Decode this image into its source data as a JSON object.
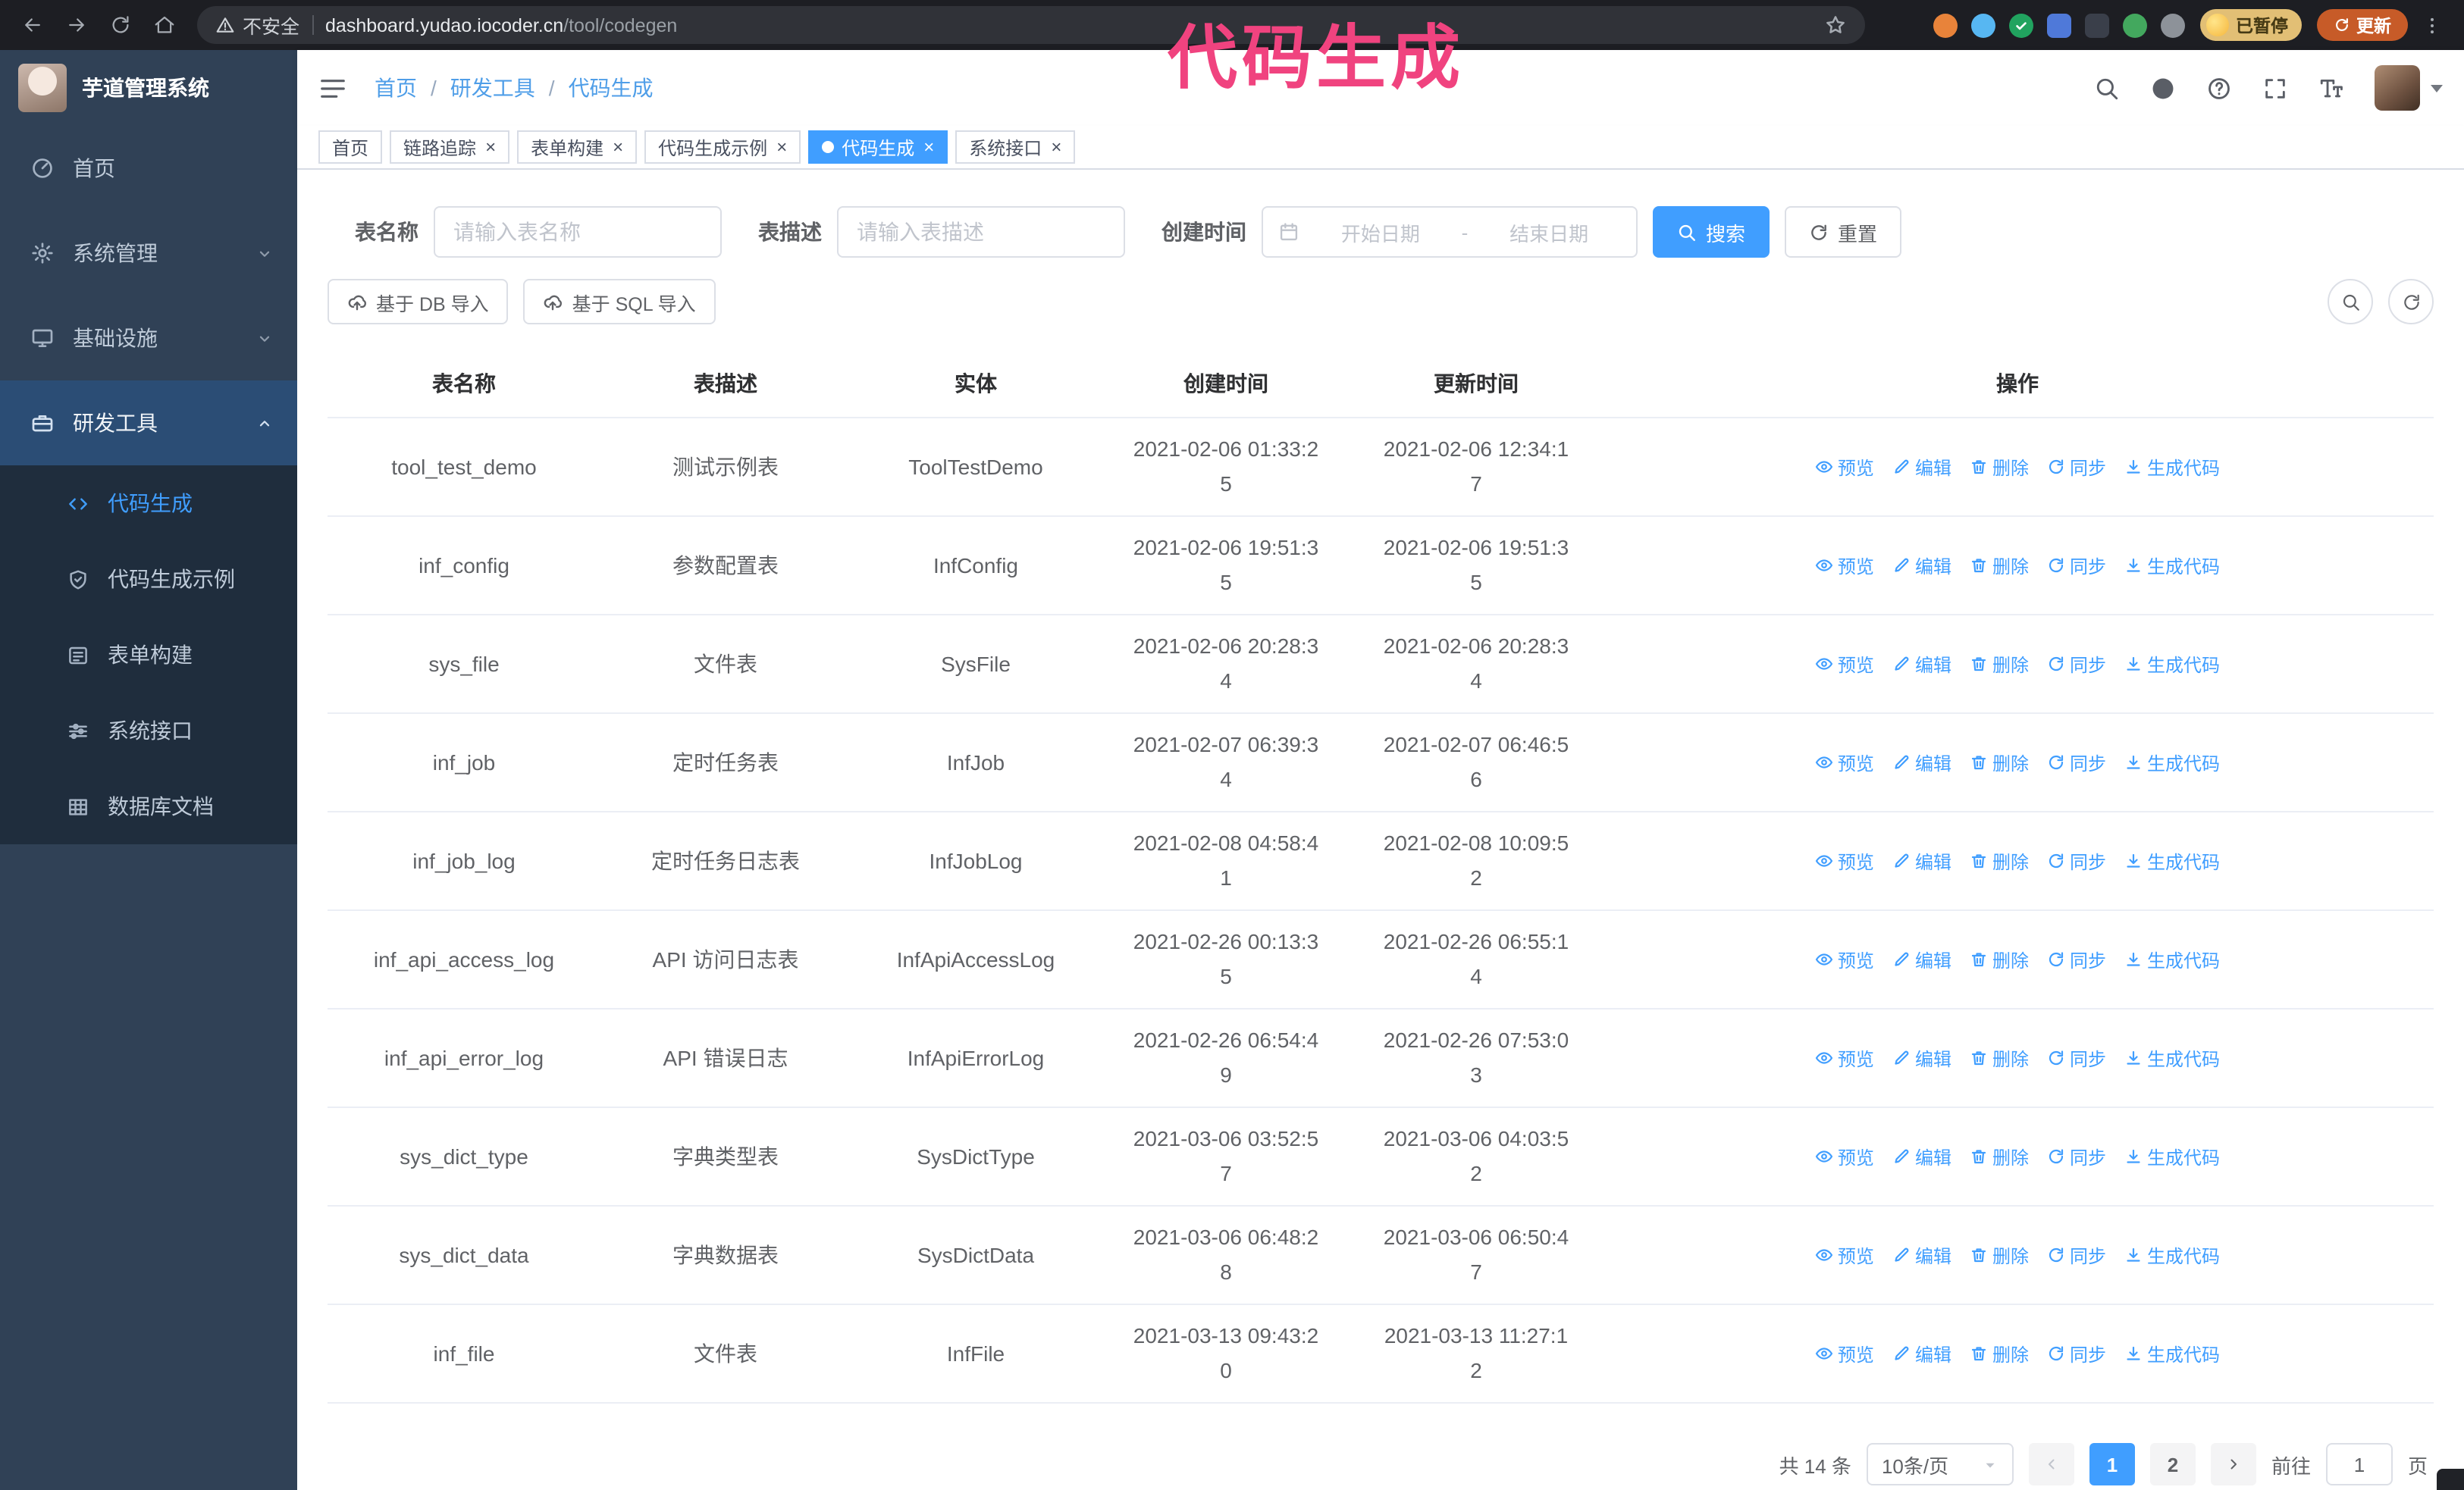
{
  "annotation": {
    "text": "代码生成",
    "color": "#f0437f"
  },
  "colors": {
    "primary": "#409eff",
    "sidebar_bg": "#304156",
    "submenu_bg": "#1f2d3d"
  },
  "browser": {
    "security_warning": "不安全",
    "url_host": "dashboard.yudao.iocoder.cn",
    "url_path": "/tool/codegen",
    "paused_badge": "已暂停",
    "update_button": "更新",
    "extensions": [
      {
        "name": "fox-extension-icon",
        "color": "#e8833a",
        "shape": "circle"
      },
      {
        "name": "drop-extension-icon",
        "color": "#57b7f2",
        "shape": "circle"
      },
      {
        "name": "verified-extension-icon",
        "color": "#21a35f",
        "shape": "circle",
        "glyph": "check-icon"
      },
      {
        "name": "people-extension-icon",
        "color": "#4f79d9",
        "shape": "square"
      },
      {
        "name": "dark-extension-icon",
        "color": "#3a3f4a",
        "shape": "square"
      },
      {
        "name": "leaf-extension-icon",
        "color": "#43a85e",
        "shape": "circle"
      },
      {
        "name": "puzzle-extension-icon",
        "color": "#8d9299",
        "shape": "circle"
      }
    ]
  },
  "app": {
    "logo_title": "芋道管理系统",
    "menu": [
      {
        "key": "home",
        "label": "首页",
        "icon": "dashboard-icon",
        "type": "item"
      },
      {
        "key": "system",
        "label": "系统管理",
        "icon": "gear-icon",
        "type": "group",
        "state": "collapsed"
      },
      {
        "key": "infra",
        "label": "基础设施",
        "icon": "monitor-icon",
        "type": "group",
        "state": "collapsed"
      },
      {
        "key": "devtools",
        "label": "研发工具",
        "icon": "toolbox-icon",
        "type": "group",
        "state": "expanded"
      }
    ],
    "submenu": [
      {
        "key": "codegen",
        "label": "代码生成",
        "icon": "code-icon",
        "active": true
      },
      {
        "key": "codegen-example",
        "label": "代码生成示例",
        "icon": "shield-icon",
        "active": false
      },
      {
        "key": "form-builder",
        "label": "表单构建",
        "icon": "form-icon",
        "active": false
      },
      {
        "key": "api",
        "label": "系统接口",
        "icon": "sliders-icon",
        "active": false
      },
      {
        "key": "db-doc",
        "label": "数据库文档",
        "icon": "grid-icon",
        "active": false
      }
    ]
  },
  "navbar": {
    "separator": "/",
    "breadcrumb": [
      {
        "label": "首页"
      },
      {
        "label": "研发工具"
      },
      {
        "label": "代码生成"
      }
    ],
    "right_icons": [
      "search-icon",
      "github-icon",
      "help-icon",
      "fullscreen-icon",
      "font-size-icon"
    ]
  },
  "tabs": [
    {
      "key": "home",
      "label": "首页",
      "closable": false,
      "active": false
    },
    {
      "key": "trace",
      "label": "链路追踪",
      "closable": true,
      "active": false
    },
    {
      "key": "form-builder",
      "label": "表单构建",
      "closable": true,
      "active": false
    },
    {
      "key": "codegen-example",
      "label": "代码生成示例",
      "closable": true,
      "active": false
    },
    {
      "key": "codegen",
      "label": "代码生成",
      "closable": true,
      "active": true
    },
    {
      "key": "api",
      "label": "系统接口",
      "closable": true,
      "active": false
    }
  ],
  "filters": {
    "table_name_label": "表名称",
    "table_name_placeholder": "请输入表名称",
    "table_desc_label": "表描述",
    "table_desc_placeholder": "请输入表描述",
    "create_time_label": "创建时间",
    "date_start_placeholder": "开始日期",
    "date_separator": "-",
    "date_end_placeholder": "结束日期",
    "search_button": "搜索",
    "reset_button": "重置"
  },
  "toolbar": {
    "import_db": "基于 DB 导入",
    "import_sql": "基于 SQL 导入"
  },
  "table": {
    "columns": [
      "表名称",
      "表描述",
      "实体",
      "创建时间",
      "更新时间",
      "操作"
    ],
    "row_actions": [
      {
        "key": "preview",
        "label": "预览",
        "icon": "eye-icon"
      },
      {
        "key": "edit",
        "label": "编辑",
        "icon": "edit-icon"
      },
      {
        "key": "delete",
        "label": "删除",
        "icon": "delete-icon"
      },
      {
        "key": "sync",
        "label": "同步",
        "icon": "sync-icon"
      },
      {
        "key": "generate",
        "label": "生成代码",
        "icon": "download-icon"
      }
    ],
    "rows": [
      {
        "name": "tool_test_demo",
        "desc": "测试示例表",
        "entity": "ToolTestDemo",
        "created": "2021-02-06 01:33:25",
        "updated": "2021-02-06 12:34:17"
      },
      {
        "name": "inf_config",
        "desc": "参数配置表",
        "entity": "InfConfig",
        "created": "2021-02-06 19:51:35",
        "updated": "2021-02-06 19:51:35"
      },
      {
        "name": "sys_file",
        "desc": "文件表",
        "entity": "SysFile",
        "created": "2021-02-06 20:28:34",
        "updated": "2021-02-06 20:28:34"
      },
      {
        "name": "inf_job",
        "desc": "定时任务表",
        "entity": "InfJob",
        "created": "2021-02-07 06:39:34",
        "updated": "2021-02-07 06:46:56"
      },
      {
        "name": "inf_job_log",
        "desc": "定时任务日志表",
        "entity": "InfJobLog",
        "created": "2021-02-08 04:58:41",
        "updated": "2021-02-08 10:09:52"
      },
      {
        "name": "inf_api_access_log",
        "desc": "API 访问日志表",
        "entity": "InfApiAccessLog",
        "created": "2021-02-26 00:13:35",
        "updated": "2021-02-26 06:55:14"
      },
      {
        "name": "inf_api_error_log",
        "desc": "API 错误日志",
        "entity": "InfApiErrorLog",
        "created": "2021-02-26 06:54:49",
        "updated": "2021-02-26 07:53:03"
      },
      {
        "name": "sys_dict_type",
        "desc": "字典类型表",
        "entity": "SysDictType",
        "created": "2021-03-06 03:52:57",
        "updated": "2021-03-06 04:03:52"
      },
      {
        "name": "sys_dict_data",
        "desc": "字典数据表",
        "entity": "SysDictData",
        "created": "2021-03-06 06:48:28",
        "updated": "2021-03-06 06:50:47"
      },
      {
        "name": "inf_file",
        "desc": "文件表",
        "entity": "InfFile",
        "created": "2021-03-13 09:43:20",
        "updated": "2021-03-13 11:27:12"
      }
    ]
  },
  "pagination": {
    "total_text": "共 14 条",
    "page_size_text": "10条/页",
    "pages": [
      "1",
      "2"
    ],
    "active_page": "1",
    "goto_prefix": "前往",
    "goto_value": "1",
    "goto_suffix": "页"
  }
}
